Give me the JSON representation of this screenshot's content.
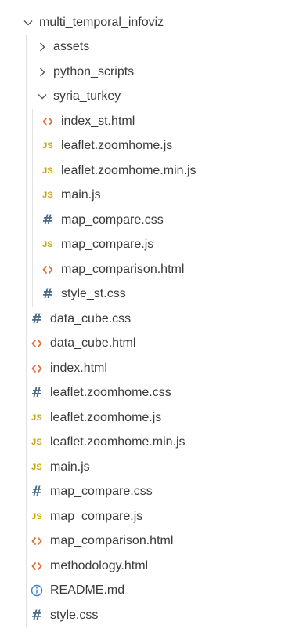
{
  "root": {
    "label": "multi_temporal_infoviz",
    "expanded": true,
    "children": [
      {
        "label": "assets",
        "kind": "folder",
        "expanded": false
      },
      {
        "label": "python_scripts",
        "kind": "folder",
        "expanded": false
      },
      {
        "label": "syria_turkey",
        "kind": "folder",
        "expanded": true
      },
      {
        "label": "index_st.html",
        "kind": "html",
        "icon": "html-file-icon"
      },
      {
        "label": "leaflet.zoomhome.js",
        "kind": "js",
        "icon": "js-file-icon"
      },
      {
        "label": "leaflet.zoomhome.min.js",
        "kind": "js",
        "icon": "js-file-icon"
      },
      {
        "label": "main.js",
        "kind": "js",
        "icon": "js-file-icon"
      },
      {
        "label": "map_compare.css",
        "kind": "css",
        "icon": "css-file-icon"
      },
      {
        "label": "map_compare.js",
        "kind": "js",
        "icon": "js-file-icon"
      },
      {
        "label": "map_comparison.html",
        "kind": "html",
        "icon": "html-file-icon"
      },
      {
        "label": "style_st.css",
        "kind": "css",
        "icon": "css-file-icon"
      },
      {
        "label": "data_cube.css",
        "kind": "css",
        "icon": "css-file-icon"
      },
      {
        "label": "data_cube.html",
        "kind": "html",
        "icon": "html-file-icon"
      },
      {
        "label": "index.html",
        "kind": "html",
        "icon": "html-file-icon"
      },
      {
        "label": "leaflet.zoomhome.css",
        "kind": "css",
        "icon": "css-file-icon"
      },
      {
        "label": "leaflet.zoomhome.js",
        "kind": "js",
        "icon": "js-file-icon"
      },
      {
        "label": "leaflet.zoomhome.min.js",
        "kind": "js",
        "icon": "js-file-icon"
      },
      {
        "label": "main.js",
        "kind": "js",
        "icon": "js-file-icon"
      },
      {
        "label": "map_compare.css",
        "kind": "css",
        "icon": "css-file-icon"
      },
      {
        "label": "map_compare.js",
        "kind": "js",
        "icon": "js-file-icon"
      },
      {
        "label": "map_comparison.html",
        "kind": "html",
        "icon": "html-file-icon"
      },
      {
        "label": "methodology.html",
        "kind": "html",
        "icon": "html-file-icon"
      },
      {
        "label": "README.md",
        "kind": "info",
        "icon": "info-file-icon"
      },
      {
        "label": "style.css",
        "kind": "css",
        "icon": "css-file-icon"
      }
    ]
  },
  "icon_glyphs": {
    "js": "JS",
    "css": "#"
  },
  "colors": {
    "js": "#c9a400",
    "css": "#4a6c8c",
    "html": "#e2703a",
    "info": "#3a7fcf",
    "text": "#3b3b3b"
  }
}
